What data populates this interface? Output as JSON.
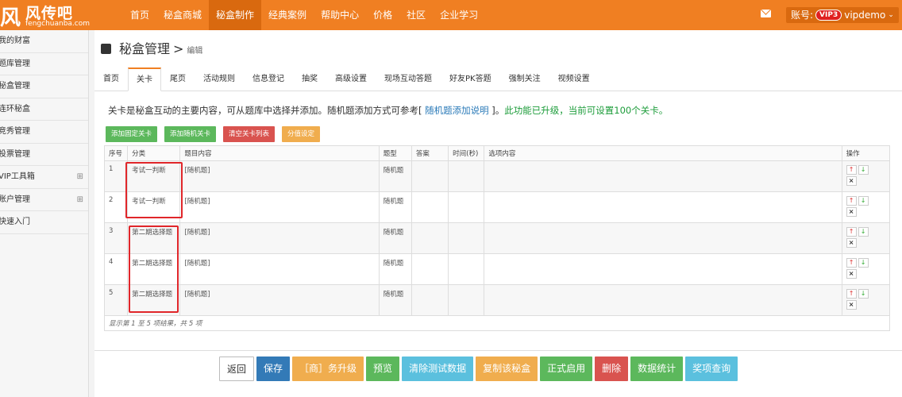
{
  "brand": {
    "mark": "风",
    "name": "风传吧",
    "domain": "fengchuanba.com"
  },
  "nav": [
    "首页",
    "秘盒商城",
    "秘盒制作",
    "经典案例",
    "帮助中心",
    "价格",
    "社区",
    "企业学习"
  ],
  "nav_active_index": 2,
  "account": {
    "label": "账号:",
    "badge": "VIP3",
    "user": "vipdemo"
  },
  "sidebar": [
    {
      "label": "我的财富",
      "expand": ""
    },
    {
      "label": "题库管理",
      "expand": ""
    },
    {
      "label": "秘盒管理",
      "expand": ""
    },
    {
      "label": "连环秘盒",
      "expand": ""
    },
    {
      "label": "竞秀管理",
      "expand": ""
    },
    {
      "label": "投票管理",
      "expand": ""
    },
    {
      "label": "VIP工具箱",
      "expand": "⊞"
    },
    {
      "label": "账户管理",
      "expand": "⊞"
    },
    {
      "label": "快速入门",
      "expand": ""
    }
  ],
  "page": {
    "title": "秘盒管理",
    "separator": ">",
    "crumb": "编辑"
  },
  "tabs": [
    "首页",
    "关卡",
    "尾页",
    "活动规则",
    "信息登记",
    "抽奖",
    "高级设置",
    "现场互动答题",
    "好友PK答题",
    "强制关注",
    "视频设置"
  ],
  "tab_active_index": 1,
  "notice": {
    "text": "关卡是秘盒互动的主要内容，可从题库中选择并添加。随机题添加方式可参考[ ",
    "link": "随机题添加说明",
    "text2": " ]。",
    "green": "此功能已升级，当前可设置100个关卡。"
  },
  "actions": [
    {
      "label": "添加固定关卡",
      "color": "#5cb85c"
    },
    {
      "label": "添加随机关卡",
      "color": "#5cb85c"
    },
    {
      "label": "清空关卡列表",
      "color": "#d9534f"
    },
    {
      "label": "分值设定",
      "color": "#f0ad4e"
    }
  ],
  "table": {
    "headers": [
      "序号",
      "分类",
      "题目内容",
      "题型",
      "答案",
      "时间(秒)",
      "选项内容",
      "操作"
    ],
    "rows": [
      {
        "no": "1",
        "category": "考试一判断",
        "content": "[随机题]",
        "type": "随机题",
        "answer": "",
        "time": "",
        "options": ""
      },
      {
        "no": "2",
        "category": "考试一判断",
        "content": "[随机题]",
        "type": "随机题",
        "answer": "",
        "time": "",
        "options": ""
      },
      {
        "no": "3",
        "category": "第二期选择题",
        "content": "[随机题]",
        "type": "随机题",
        "answer": "",
        "time": "",
        "options": ""
      },
      {
        "no": "4",
        "category": "第二期选择题",
        "content": "[随机题]",
        "type": "随机题",
        "answer": "",
        "time": "",
        "options": ""
      },
      {
        "no": "5",
        "category": "第二期选择题",
        "content": "[随机题]",
        "type": "随机题",
        "answer": "",
        "time": "",
        "options": ""
      }
    ],
    "footer": "显示第 1 至 5 项结果，共 5 项"
  },
  "bottom_buttons": [
    {
      "label": "返回",
      "color": "#ffffff"
    },
    {
      "label": "保存",
      "color": "#337ab7"
    },
    {
      "label": "［商］务升级",
      "color": "#f0ad4e"
    },
    {
      "label": "预览",
      "color": "#5cb85c"
    },
    {
      "label": "清除测试数据",
      "color": "#5bc0de"
    },
    {
      "label": "复制该秘盒",
      "color": "#f0ad4e"
    },
    {
      "label": "正式启用",
      "color": "#5cb85c"
    },
    {
      "label": "删除",
      "color": "#d9534f"
    },
    {
      "label": "数据统计",
      "color": "#5cb85c"
    },
    {
      "label": "奖项查询",
      "color": "#5bc0de"
    }
  ],
  "icons": {
    "mail": "mail-icon",
    "up": "arrow-up-icon",
    "down": "arrow-down-icon",
    "delete": "close-icon"
  }
}
